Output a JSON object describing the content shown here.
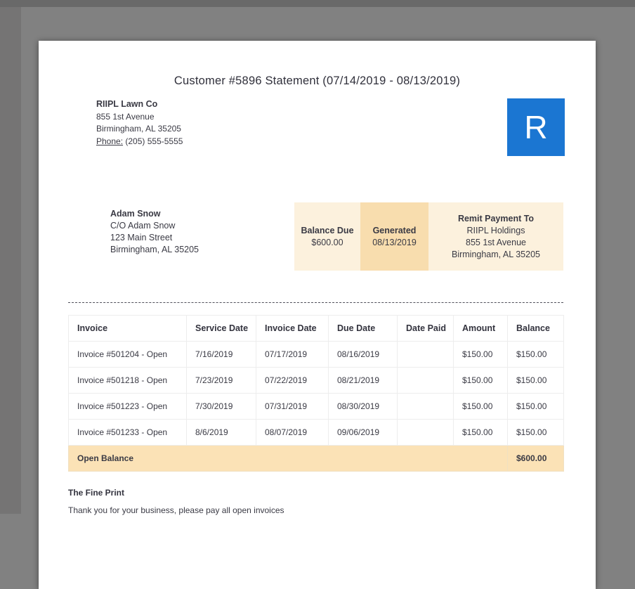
{
  "doc": {
    "title": "Customer #5896 Statement (07/14/2019 - 08/13/2019)"
  },
  "company": {
    "name": "RIIPL Lawn Co",
    "address_line1": "855 1st Avenue",
    "address_line2": "Birmingham, AL 35205",
    "phone_label": "Phone:",
    "phone": "(205) 555-5555",
    "logo_letter": "R"
  },
  "customer": {
    "name": "Adam Snow",
    "care_of": "C/O Adam Snow",
    "address_line1": "123 Main Street",
    "address_line2": "Birmingham, AL 35205"
  },
  "summary": {
    "balance_due_label": "Balance Due",
    "balance_due_value": "$600.00",
    "generated_label": "Generated",
    "generated_value": "08/13/2019",
    "remit_label": "Remit Payment To",
    "remit_name": "RIIPL Holdings",
    "remit_address1": "855 1st Avenue",
    "remit_address2": "Birmingham, AL 35205"
  },
  "table": {
    "headers": [
      "Invoice",
      "Service Date",
      "Invoice Date",
      "Due Date",
      "Date Paid",
      "Amount",
      "Balance"
    ],
    "rows": [
      [
        "Invoice #501204 - Open",
        "7/16/2019",
        "07/17/2019",
        "08/16/2019",
        "",
        "$150.00",
        "$150.00"
      ],
      [
        "Invoice #501218 - Open",
        "7/23/2019",
        "07/22/2019",
        "08/21/2019",
        "",
        "$150.00",
        "$150.00"
      ],
      [
        "Invoice #501223 - Open",
        "7/30/2019",
        "07/31/2019",
        "08/30/2019",
        "",
        "$150.00",
        "$150.00"
      ],
      [
        "Invoice #501233 - Open",
        "8/6/2019",
        "08/07/2019",
        "09/06/2019",
        "",
        "$150.00",
        "$150.00"
      ]
    ],
    "footer": {
      "label": "Open Balance",
      "balance": "$600.00"
    }
  },
  "fine_print": {
    "heading": "The Fine Print",
    "text": "Thank you for your business, please pay all open invoices"
  },
  "colors": {
    "brand_blue": "#1b76d2",
    "summary_bg": "#fcf1dd",
    "summary_highlight_bg": "#f8ddae",
    "open_balance_bg": "#fbe2b6"
  }
}
